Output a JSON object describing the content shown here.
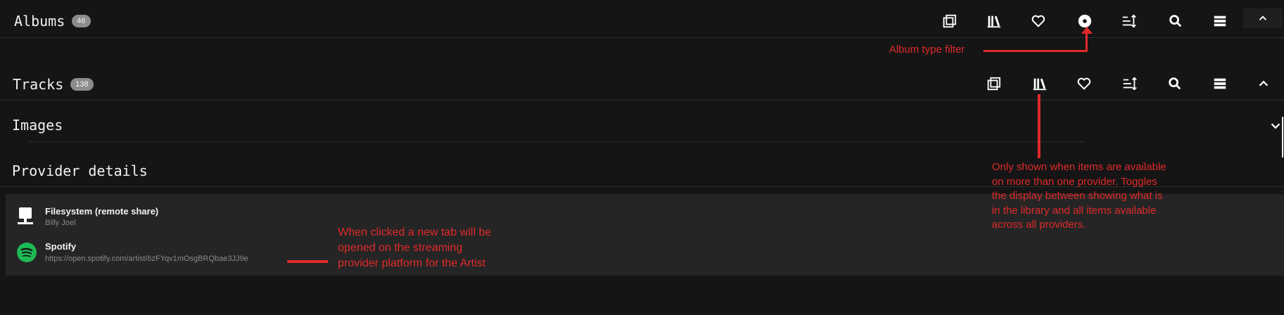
{
  "albums": {
    "title": "Albums",
    "count": "46"
  },
  "tracks": {
    "title": "Tracks",
    "count": "138"
  },
  "images": {
    "title": "Images"
  },
  "provider_details": {
    "title": "Provider details"
  },
  "providers": [
    {
      "name": "Filesystem (remote share)",
      "sub": "Billy Joel",
      "icon": "server-icon"
    },
    {
      "name": "Spotify",
      "sub": "https://open.spotify.com/artist/6zFYqv1mOsgBRQbae3JJ9e",
      "icon": "spotify-icon"
    }
  ],
  "annotations": {
    "album_type": "Album type filter",
    "provider_toggle": [
      "Only shown when items are available",
      "on more than one provider. Toggles",
      "the display between showing what is",
      "in the library and all items available",
      "across all providers."
    ],
    "spotify_link": [
      "When clicked a new tab will be",
      "opened on the streaming",
      "provider platform for the Artist"
    ]
  },
  "colors": {
    "background": "#151515",
    "panel": "#252525",
    "annotation": "#e02a2a",
    "spotify": "#1db954"
  }
}
